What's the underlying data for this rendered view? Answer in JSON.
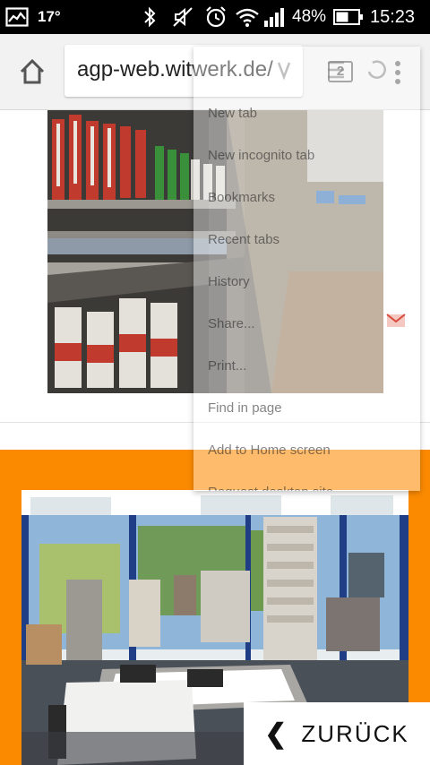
{
  "status_bar": {
    "temperature": "17°",
    "battery_percent": "48%",
    "time": "15:23",
    "icons": [
      "gallery-icon",
      "bluetooth-icon",
      "silent-icon",
      "alarm-icon",
      "wifi-icon",
      "signal-icon",
      "battery-icon"
    ]
  },
  "toolbar": {
    "url": "agp-web.witwerk.de/",
    "tab_count": "2"
  },
  "menu": {
    "items": [
      "New tab",
      "New incognito tab",
      "Bookmarks",
      "Recent tabs",
      "History",
      "Share...",
      "Print...",
      "Find in page",
      "Add to Home screen",
      "Request desktop site"
    ]
  },
  "page": {
    "back_button": "ZURÜCK",
    "photo_top_alt": "",
    "photo_bottom_alt": ""
  },
  "colors": {
    "accent_orange": "#fb8a00",
    "status_bar": "#000000",
    "toolbar": "#f2f2f2"
  }
}
